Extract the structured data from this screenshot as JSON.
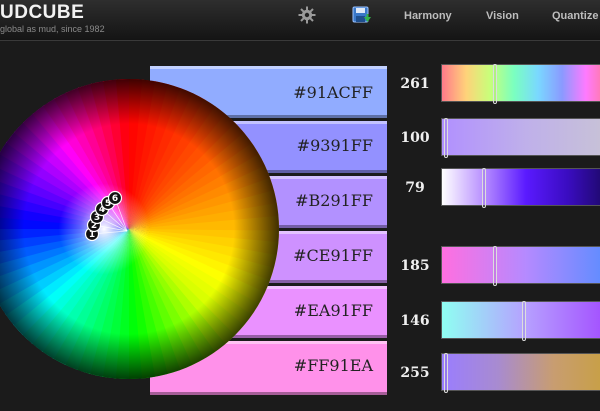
{
  "header": {
    "logo": "UDCUBE",
    "tagline": "global as mud, since 1982",
    "nav": [
      "Harmony",
      "Vision",
      "Quantize"
    ],
    "icons": [
      "gear-icon",
      "save-icon"
    ]
  },
  "wheel": {
    "handles": [
      "1",
      "2",
      "3",
      "4",
      "5",
      "6"
    ]
  },
  "swatches": [
    {
      "hex": "#91ACFF",
      "color": "#91ACFF"
    },
    {
      "hex": "#9391FF",
      "color": "#9391FF"
    },
    {
      "hex": "#B291FF",
      "color": "#B291FF"
    },
    {
      "hex": "#CE91FF",
      "color": "#CE91FF"
    },
    {
      "hex": "#EA91FF",
      "color": "#EA91FF"
    },
    {
      "hex": "#FF91EA",
      "color": "#FF91EA"
    }
  ],
  "sliders": [
    {
      "value": "261",
      "thumb_fraction": 0.31,
      "gradient": "linear-gradient(90deg,#ff7a8a,#ffd27a,#c8ff7a,#7affc0,#7ad8ff,#8a9aff,#ff7aff,#ff7a8a)"
    },
    {
      "value": "100",
      "thumb_fraction": 0.01,
      "gradient": "linear-gradient(90deg,#b190ff,#bfb0ea,#c8c3d6)"
    },
    {
      "value": "79",
      "thumb_fraction": 0.24,
      "gradient": "linear-gradient(90deg,#ffffff,#b78eff,#5a1aff,#3a0cc0,#1a0860)"
    },
    {
      "value": "185",
      "thumb_fraction": 0.31,
      "gradient": "linear-gradient(90deg,#ff6fe0,#b58aff,#5a8cff)"
    },
    {
      "value": "146",
      "thumb_fraction": 0.48,
      "gradient": "linear-gradient(90deg,#8ffff2,#b6a0ff,#a24bff)"
    },
    {
      "value": "255",
      "thumb_fraction": 0.01,
      "gradient": "linear-gradient(90deg,#9a7dff,#a88bd0,#c89d70,#c8a040)"
    }
  ]
}
